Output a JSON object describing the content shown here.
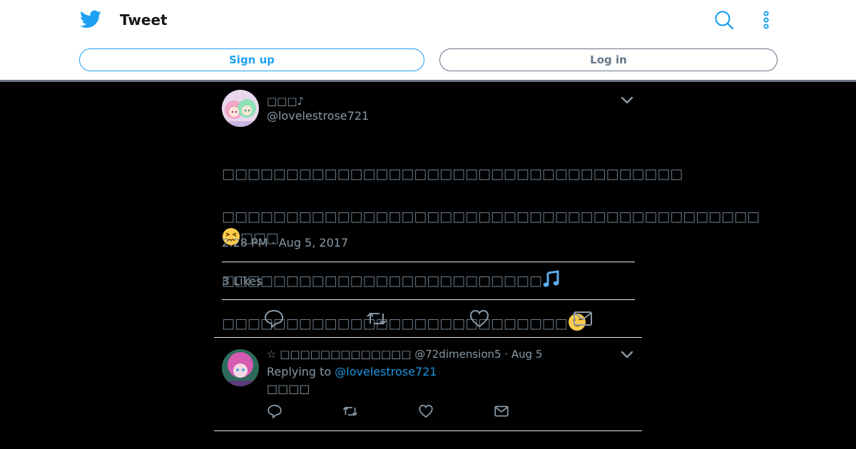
{
  "header": {
    "title": "Tweet",
    "signup_label": "Sign up",
    "login_label": "Log in",
    "accent_color": "#1da1f2",
    "icons": [
      "twitter-bird-icon",
      "search-icon",
      "more-vertical-icon"
    ]
  },
  "tweet": {
    "display_name": "□□□♪",
    "handle": "@lovelestrose721",
    "lines": [
      "□□□□□□□□□□□□□□□□□□□□□□□□□□□□□□□□□□□□",
      "□□□□□□□□□□□□□□□□□□□□□□□□□□□□□□□□□□□□□□□□□□",
      "□□□□□□□□□□□□□□□□□□□□□□□□□",
      "□□□□□□□□□□□□□□□□□□□□□□□□□□□"
    ],
    "line2_tail": "□□□",
    "emojis": [
      "persevering-face",
      "musical-notes",
      "winking-face"
    ],
    "timestamp": "2:28 PM · Aug 5, 2017",
    "likes_count": "3",
    "likes_label": "Likes"
  },
  "reply": {
    "meta": "☆ □□□□□□□□□□□□□ @72dimension5 · Aug 5",
    "replying_prefix": "Replying to",
    "replying_handle": "@lovelestrose721",
    "text": "□□□□"
  }
}
